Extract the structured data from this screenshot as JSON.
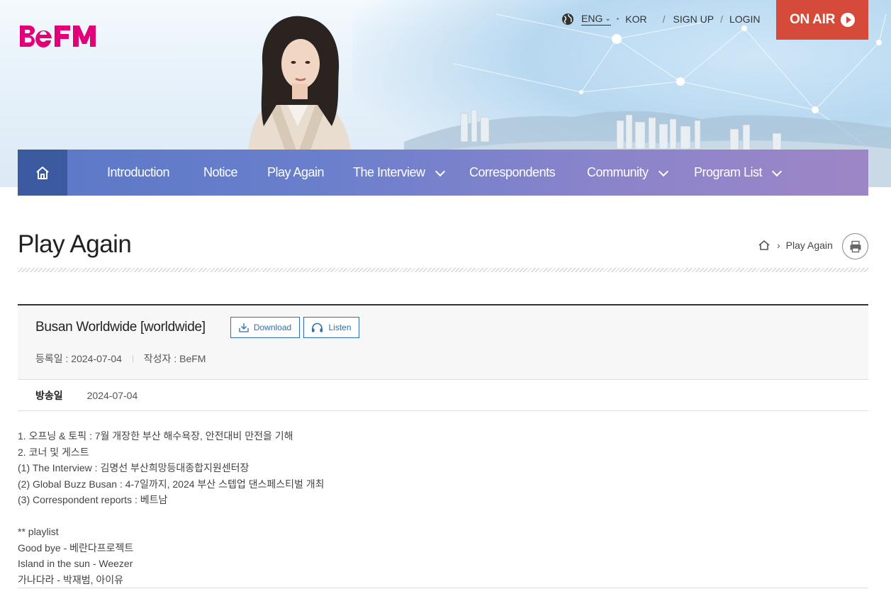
{
  "header": {
    "logo_text": "BeFM",
    "brand_color": "#e2007a",
    "util": {
      "lang_eng": "ENG",
      "lang_kor": "KOR",
      "sign_up": "SIGN UP",
      "login": "LOGIN"
    },
    "on_air": "ON AIR",
    "on_air_color": "#d64a3a"
  },
  "nav": {
    "items": [
      {
        "label": "Introduction",
        "dropdown": false
      },
      {
        "label": "Notice",
        "dropdown": false
      },
      {
        "label": "Play Again",
        "dropdown": false
      },
      {
        "label": "The Interview",
        "dropdown": true
      },
      {
        "label": "Correspondents",
        "dropdown": false
      },
      {
        "label": "Community",
        "dropdown": true
      },
      {
        "label": "Program List",
        "dropdown": true
      }
    ]
  },
  "page": {
    "title": "Play Again",
    "breadcrumb_current": "Play Again"
  },
  "post": {
    "title": "Busan Worldwide [worldwide]",
    "download_label": "Download",
    "listen_label": "Listen",
    "reg_date": "등록일 : 2024-07-04",
    "author": "작성자 : BeFM",
    "broadcast_label": "방송일",
    "broadcast_date": "2024-07-04",
    "lines": [
      "1. 오프닝 & 토픽 : 7월 개장한 부산 해수욕장, 안전대비 만전을 기해",
      "2. 코너 및 게스트",
      "(1) The Interview : 김명선 부산희망등대종합지원센터장",
      "(2) Global Buzz Busan : 4-7일까지, 2024 부산 스텝업 댄스페스티벌 개최",
      "(3) Correspondent reports : 베트남",
      "",
      "** playlist",
      "Good bye - 베란다프로젝트",
      "Island in the sun - Weezer",
      "가나다라 - 박재범, 아이유"
    ]
  }
}
